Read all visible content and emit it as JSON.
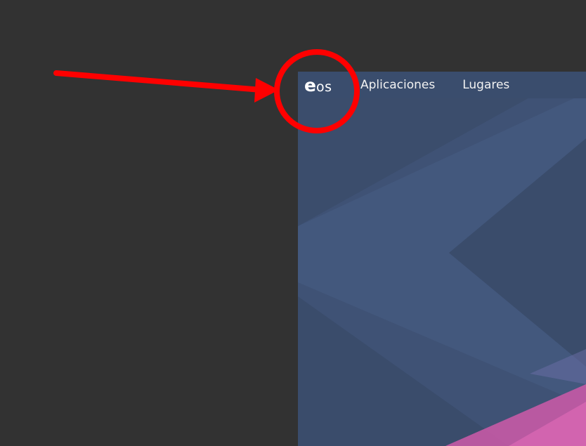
{
  "topbar": {
    "logo_e": "e",
    "logo_os": "os",
    "menu_items": [
      {
        "label": "Aplicaciones"
      },
      {
        "label": "Lugares"
      }
    ]
  },
  "colors": {
    "outer_background": "#323232",
    "wallpaper_base": "#3f5275",
    "topbar": "#3a4d6d",
    "wallpaper_accent": "#c65aa6",
    "annotation_red": "#ff0000"
  },
  "annotation": {
    "shapes": [
      "arrow-icon",
      "circle-highlight-icon"
    ]
  }
}
